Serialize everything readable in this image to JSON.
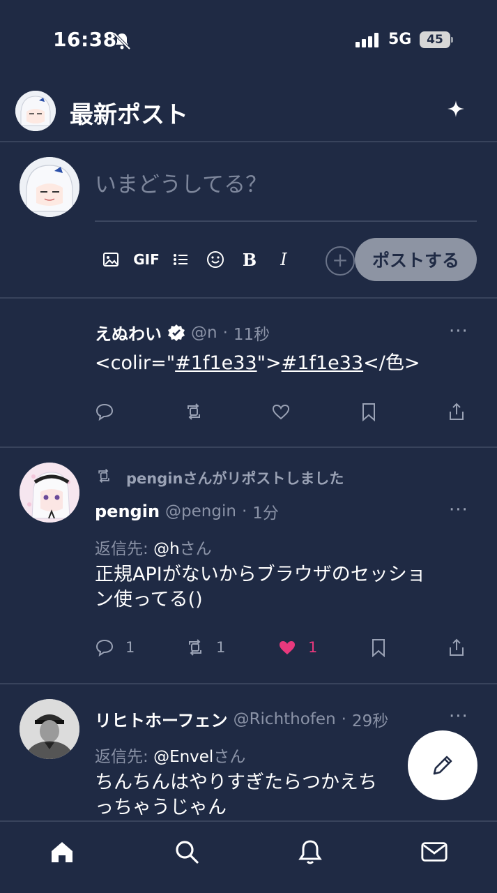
{
  "status_bar": {
    "time": "16:38",
    "network": "5G",
    "battery": "45"
  },
  "header": {
    "title": "最新ポスト"
  },
  "compose": {
    "placeholder": "いまどうしてる？",
    "tools": {
      "gif_label": "GIF",
      "bold_label": "B",
      "italic_label": "I",
      "plus_label": "+"
    },
    "post_button_label": "ポストする"
  },
  "posts": [
    {
      "name": "えぬわい",
      "verified": true,
      "handle": "@n",
      "separator": "·",
      "time": "11秒",
      "body_parts": [
        "<colir=\"",
        "#1f1e33",
        "\">",
        "#1f1e33",
        "</色>"
      ],
      "more": "···"
    },
    {
      "repost_by": "penginさんがリポストしました",
      "name": "pengin",
      "handle": "@pengin",
      "separator": "·",
      "time": "1分",
      "reply_to_prefix": "返信先:",
      "reply_to_handle": "@h",
      "reply_to_suffix": "さん",
      "body_line1": "正規APIがないからブラウザのセッショ",
      "body_line2": "ン使ってる()",
      "more": "···",
      "reply_count": "1",
      "repost_count": "1",
      "like_count": "1",
      "liked": true
    },
    {
      "name": "リヒトホーフェン",
      "handle": "@Richthofen",
      "separator": "·",
      "time": "29秒",
      "reply_to_prefix": "返信先:",
      "reply_to_handle": "@Envel",
      "reply_to_suffix": "さん",
      "body_line1": "ちんちんはやりすぎたらつかえち",
      "body_line2": "っちゃうじゃん",
      "more": "···"
    }
  ],
  "colors": {
    "background": "#1f2a44",
    "divider": "#38435c",
    "muted": "#9aa2b5",
    "like": "#e8397d",
    "post_button": "#8d94a3"
  },
  "icons": {
    "tabs": [
      "home-icon",
      "search-icon",
      "bell-icon",
      "mail-icon"
    ],
    "fab": "pencil-icon"
  }
}
